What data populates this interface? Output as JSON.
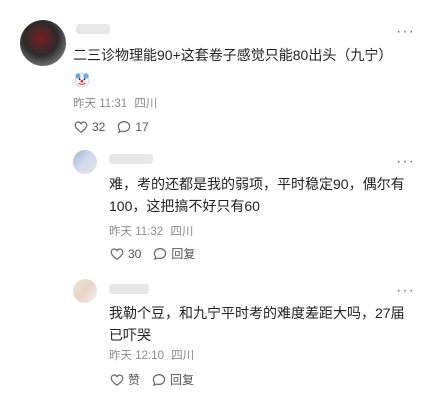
{
  "main_comment": {
    "text": "二三诊物理能90+这套卷子感觉只能80出头（九宁）",
    "time": "昨天 11:31",
    "location": "四川",
    "likes": "32",
    "replies": "17"
  },
  "replies": [
    {
      "text_line1": "难，考的还都是我的弱项，平时稳定90，偶尔有",
      "text_line2": "100，这把搞不好只有60",
      "time": "昨天 11:32",
      "location": "四川",
      "likes": "30",
      "reply_label": "回复"
    },
    {
      "text_line1": "我勒个豆，和九宁平时考的难度差距大吗，27届",
      "text_line2": "已吓哭",
      "time": "昨天 12:10",
      "location": "四川",
      "likes": "赞",
      "reply_label": "回复"
    }
  ],
  "icons": {
    "more": "more-icon",
    "like": "thumb-up-icon",
    "comment": "comment-bubble-icon",
    "emoji": "clown-emoji-icon"
  }
}
